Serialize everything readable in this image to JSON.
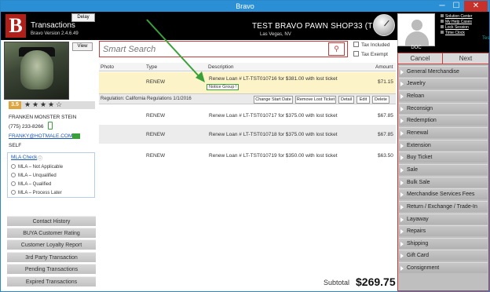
{
  "window": {
    "title": "Bravo",
    "min": "─",
    "max": "☐",
    "close": "✕"
  },
  "header": {
    "logo": "B",
    "app_title": "Transactions",
    "app_version": "Bravo Version 2.4.6.49",
    "delay_label": "Delay",
    "store_name": "TEST BRAVO PAWN SHOP33 (TST)",
    "store_location": "Las Vegas, NV"
  },
  "user": {
    "name": "DOC",
    "links": [
      "Solution Center",
      "My Help Cases",
      "Lock Session",
      "Time Clock"
    ],
    "tag": "Tes"
  },
  "customer": {
    "view_label": "View",
    "rating": "3.5",
    "stars": [
      "★",
      "★",
      "★",
      "★",
      "☆"
    ],
    "name": "FRANKEN MONSTER STEIN",
    "phone": "(775) 233-8266",
    "email": "FRANKY@HOTMALE.COM",
    "relation": "SELF",
    "mla_title": "MLA Check",
    "mla_help": "ⓘ",
    "mla_options": [
      "MLA – Not Applicable",
      "MLA – Unqualified",
      "MLA – Qualified",
      "MLA – Process Later"
    ]
  },
  "left_buttons": [
    "Contact History",
    "BUYA Customer Rating",
    "Customer Loyalty Report",
    "3rd Party Transaction",
    "Pending Transactions",
    "Expired Transactions"
  ],
  "search": {
    "placeholder": "Smart Search",
    "button": "⚲"
  },
  "checkboxes": [
    "Tax Included",
    "Tax Exempt"
  ],
  "grid": {
    "headers": {
      "photo": "Photo",
      "type": "Type",
      "description": "Description",
      "amount": "Amount"
    },
    "rows": [
      {
        "type": "RENEW",
        "description": "Renew Loan # LT-TST010716 for $381.00 with lost ticket",
        "amount": "$71.15",
        "notice": "Notice Group !"
      },
      {
        "type": "RENEW",
        "description": "Renew Loan # LT-TST010717 for $375.00 with lost ticket",
        "amount": "$67.85"
      },
      {
        "type": "RENEW",
        "description": "Renew Loan # LT-TST010718 for $375.00 with lost ticket",
        "amount": "$67.85"
      },
      {
        "type": "RENEW",
        "description": "Renew Loan # LT-TST010719 for $350.00 with lost ticket",
        "amount": "$63.50"
      }
    ],
    "regulation": "Regulation: California Regulations 1/1/2016",
    "reg_buttons": [
      "Change Start Date",
      "Remove Lost Ticket",
      "Detail",
      "Edit",
      "Delete"
    ]
  },
  "subtotal": {
    "label": "Subtotal",
    "value": "$269.75"
  },
  "actions": {
    "cancel": "Cancel",
    "next": "Next"
  },
  "transaction_types": [
    "General Merchandise",
    "Jewelry",
    "Reloan",
    "Reconsign",
    "Redemption",
    "Renewal",
    "Extension",
    "Buy Ticket",
    "Sale",
    "Bulk Sale",
    "Merchandise Services Fees",
    "Return / Exchange / Trade-In",
    "Layaway",
    "Repairs",
    "Shipping",
    "Gift Card",
    "Consignment"
  ],
  "colors": {
    "accent_red": "#c73b3b",
    "title_blue": "#2b8fd6",
    "header_black": "#000000",
    "highlight_row": "#fdf3c8",
    "annotation_green": "#3aa13a"
  }
}
